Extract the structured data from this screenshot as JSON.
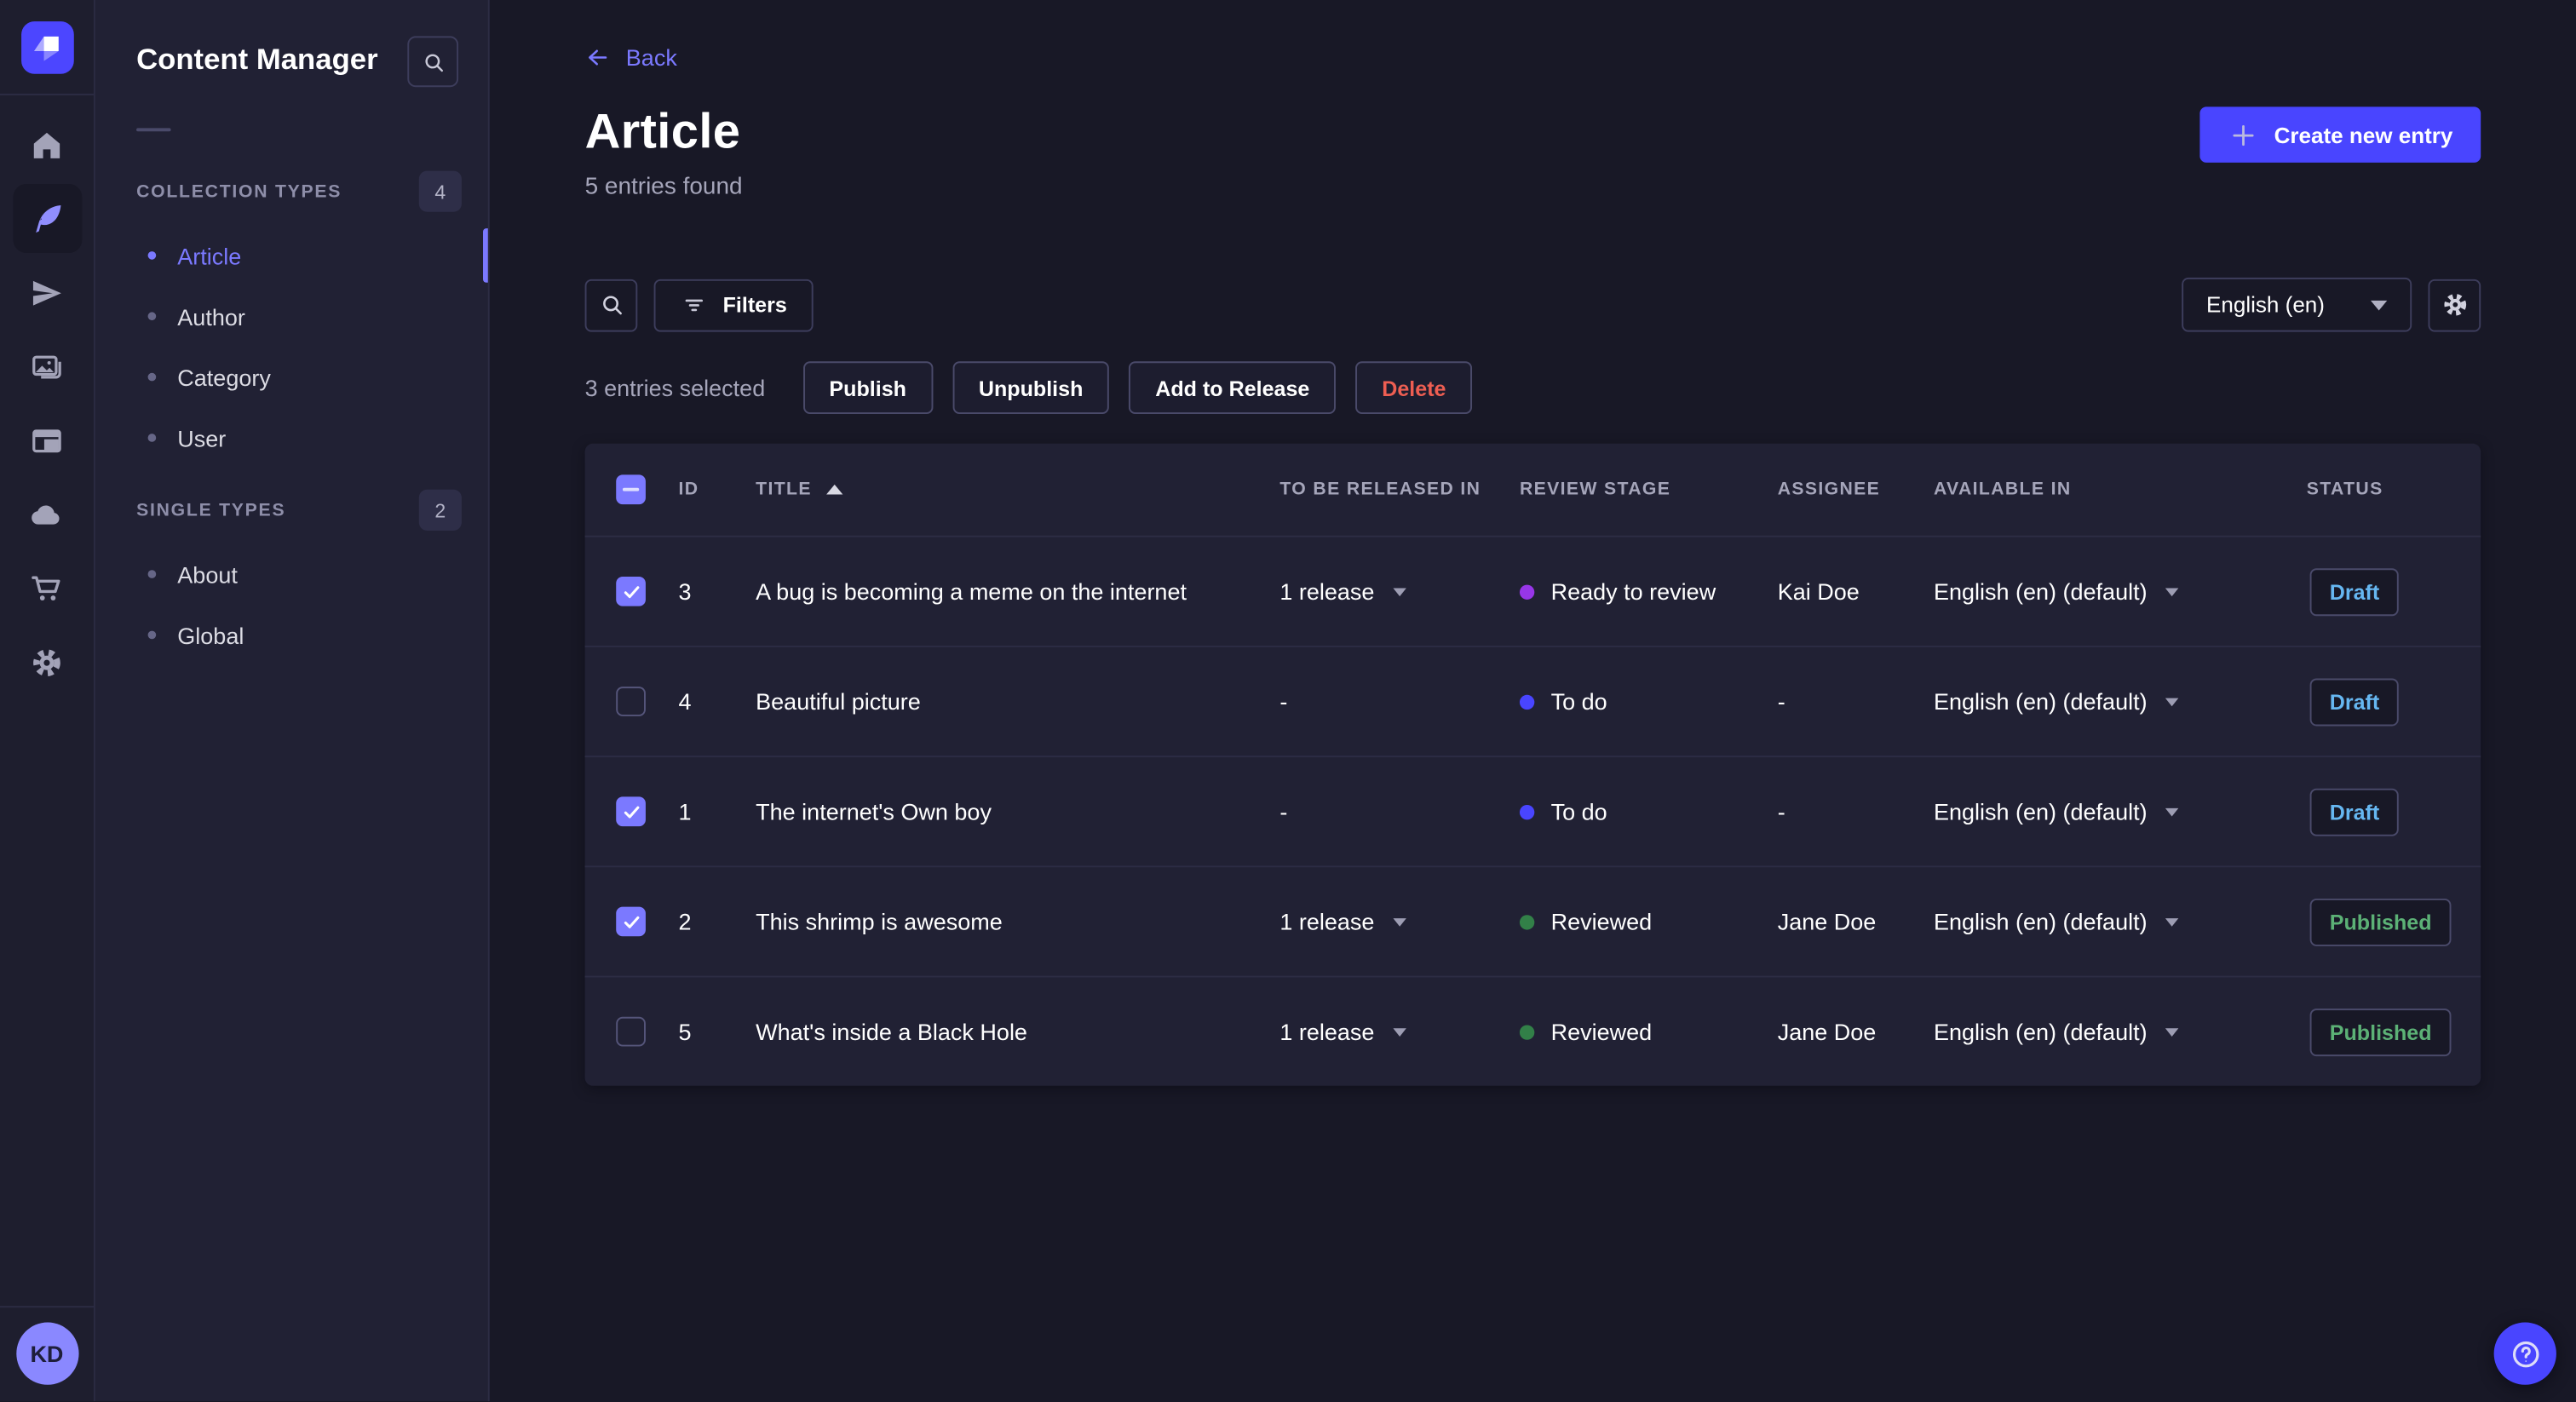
{
  "colors": {
    "accent": "#4945ff",
    "accent_light": "#7b79ff",
    "page_bg": "#181826",
    "panel_bg": "#212134",
    "border_strong": "#4a4a6a",
    "text_muted": "#a5a5ba",
    "danger": "#ee5e52",
    "draft_text": "#66b7f1",
    "published_text": "#5cb176",
    "stage_ready_to_review": "#9736e8",
    "stage_to_do": "#4945ff",
    "stage_reviewed": "#328048"
  },
  "icons": {
    "rail": [
      "strapi-logo",
      "home-icon",
      "feather-icon",
      "send-icon",
      "media-icon",
      "layout-icon",
      "cloud-icon",
      "cart-icon",
      "gear-icon"
    ],
    "toolbar": [
      "search-icon",
      "filter-icon",
      "caret-down-icon",
      "gear-icon"
    ],
    "misc": [
      "back-arrow-icon",
      "plus-icon",
      "sort-asc-icon",
      "check-icon",
      "indeterminate-dash-icon",
      "help-icon"
    ]
  },
  "rail": {
    "avatar_initials": "KD"
  },
  "subnav": {
    "title": "Content Manager",
    "sections": [
      {
        "label": "COLLECTION TYPES",
        "badge": "4",
        "items": [
          {
            "label": "Article",
            "active": true
          },
          {
            "label": "Author",
            "active": false
          },
          {
            "label": "Category",
            "active": false
          },
          {
            "label": "User",
            "active": false
          }
        ]
      },
      {
        "label": "SINGLE TYPES",
        "badge": "2",
        "items": [
          {
            "label": "About",
            "active": false
          },
          {
            "label": "Global",
            "active": false
          }
        ]
      }
    ]
  },
  "header": {
    "back_label": "Back",
    "title": "Article",
    "subtitle": "5 entries found",
    "create_label": "Create new entry"
  },
  "toolbar": {
    "filters_label": "Filters",
    "locale_value": "English (en)"
  },
  "selection": {
    "summary": "3 entries selected",
    "actions": {
      "publish": "Publish",
      "unpublish": "Unpublish",
      "add_to_release": "Add to Release",
      "delete": "Delete"
    }
  },
  "table": {
    "columns": {
      "id": "ID",
      "title": "TITLE",
      "release": "TO BE RELEASED IN",
      "stage": "REVIEW STAGE",
      "assignee": "ASSIGNEE",
      "available": "AVAILABLE IN",
      "status": "STATUS"
    },
    "rows": [
      {
        "checked": true,
        "id": "3",
        "title": "A bug is becoming a meme on the internet",
        "release": "1 release",
        "has_release_menu": true,
        "stage": "Ready to review",
        "stage_color": "#9736e8",
        "assignee": "Kai Doe",
        "available": "English (en) (default)",
        "status": "Draft",
        "status_color": "#66b7f1"
      },
      {
        "checked": false,
        "id": "4",
        "title": "Beautiful picture",
        "release": "-",
        "has_release_menu": false,
        "stage": "To do",
        "stage_color": "#4945ff",
        "assignee": "-",
        "available": "English (en) (default)",
        "status": "Draft",
        "status_color": "#66b7f1"
      },
      {
        "checked": true,
        "id": "1",
        "title": "The internet's Own boy",
        "release": "-",
        "has_release_menu": false,
        "stage": "To do",
        "stage_color": "#4945ff",
        "assignee": "-",
        "available": "English (en) (default)",
        "status": "Draft",
        "status_color": "#66b7f1"
      },
      {
        "checked": true,
        "id": "2",
        "title": "This shrimp is awesome",
        "release": "1 release",
        "has_release_menu": true,
        "stage": "Reviewed",
        "stage_color": "#328048",
        "assignee": "Jane Doe",
        "available": "English (en) (default)",
        "status": "Published",
        "status_color": "#5cb176"
      },
      {
        "checked": false,
        "id": "5",
        "title": "What's inside a Black Hole",
        "release": "1 release",
        "has_release_menu": true,
        "stage": "Reviewed",
        "stage_color": "#328048",
        "assignee": "Jane Doe",
        "available": "English (en) (default)",
        "status": "Published",
        "status_color": "#5cb176"
      }
    ]
  }
}
